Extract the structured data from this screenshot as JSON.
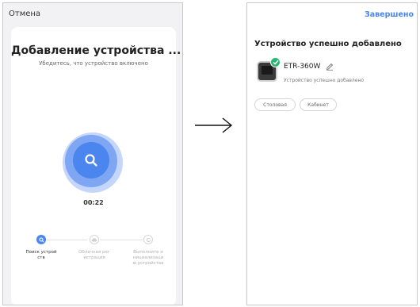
{
  "search_screen": {
    "cancel_label": "Отмена",
    "title": "Добавление устройства ...",
    "subtitle": "Убедитесь, что устройство включено",
    "timer": "00:22",
    "steps": [
      {
        "label": "Поиск устройств",
        "state": "active"
      },
      {
        "label": "Облачная регистрация",
        "state": "pending"
      },
      {
        "label": "Выполните инициализацию устройства",
        "state": "pending"
      }
    ]
  },
  "result_screen": {
    "done_label": "Завершено",
    "title": "Устройство успешно добавлено",
    "device": {
      "name": "ETR-360W",
      "status": "Устройство успешно добавлено"
    },
    "rooms": [
      "Столовая",
      "Кабинет"
    ]
  },
  "colors": {
    "accent": "#4a86ee",
    "success": "#2bb673"
  }
}
